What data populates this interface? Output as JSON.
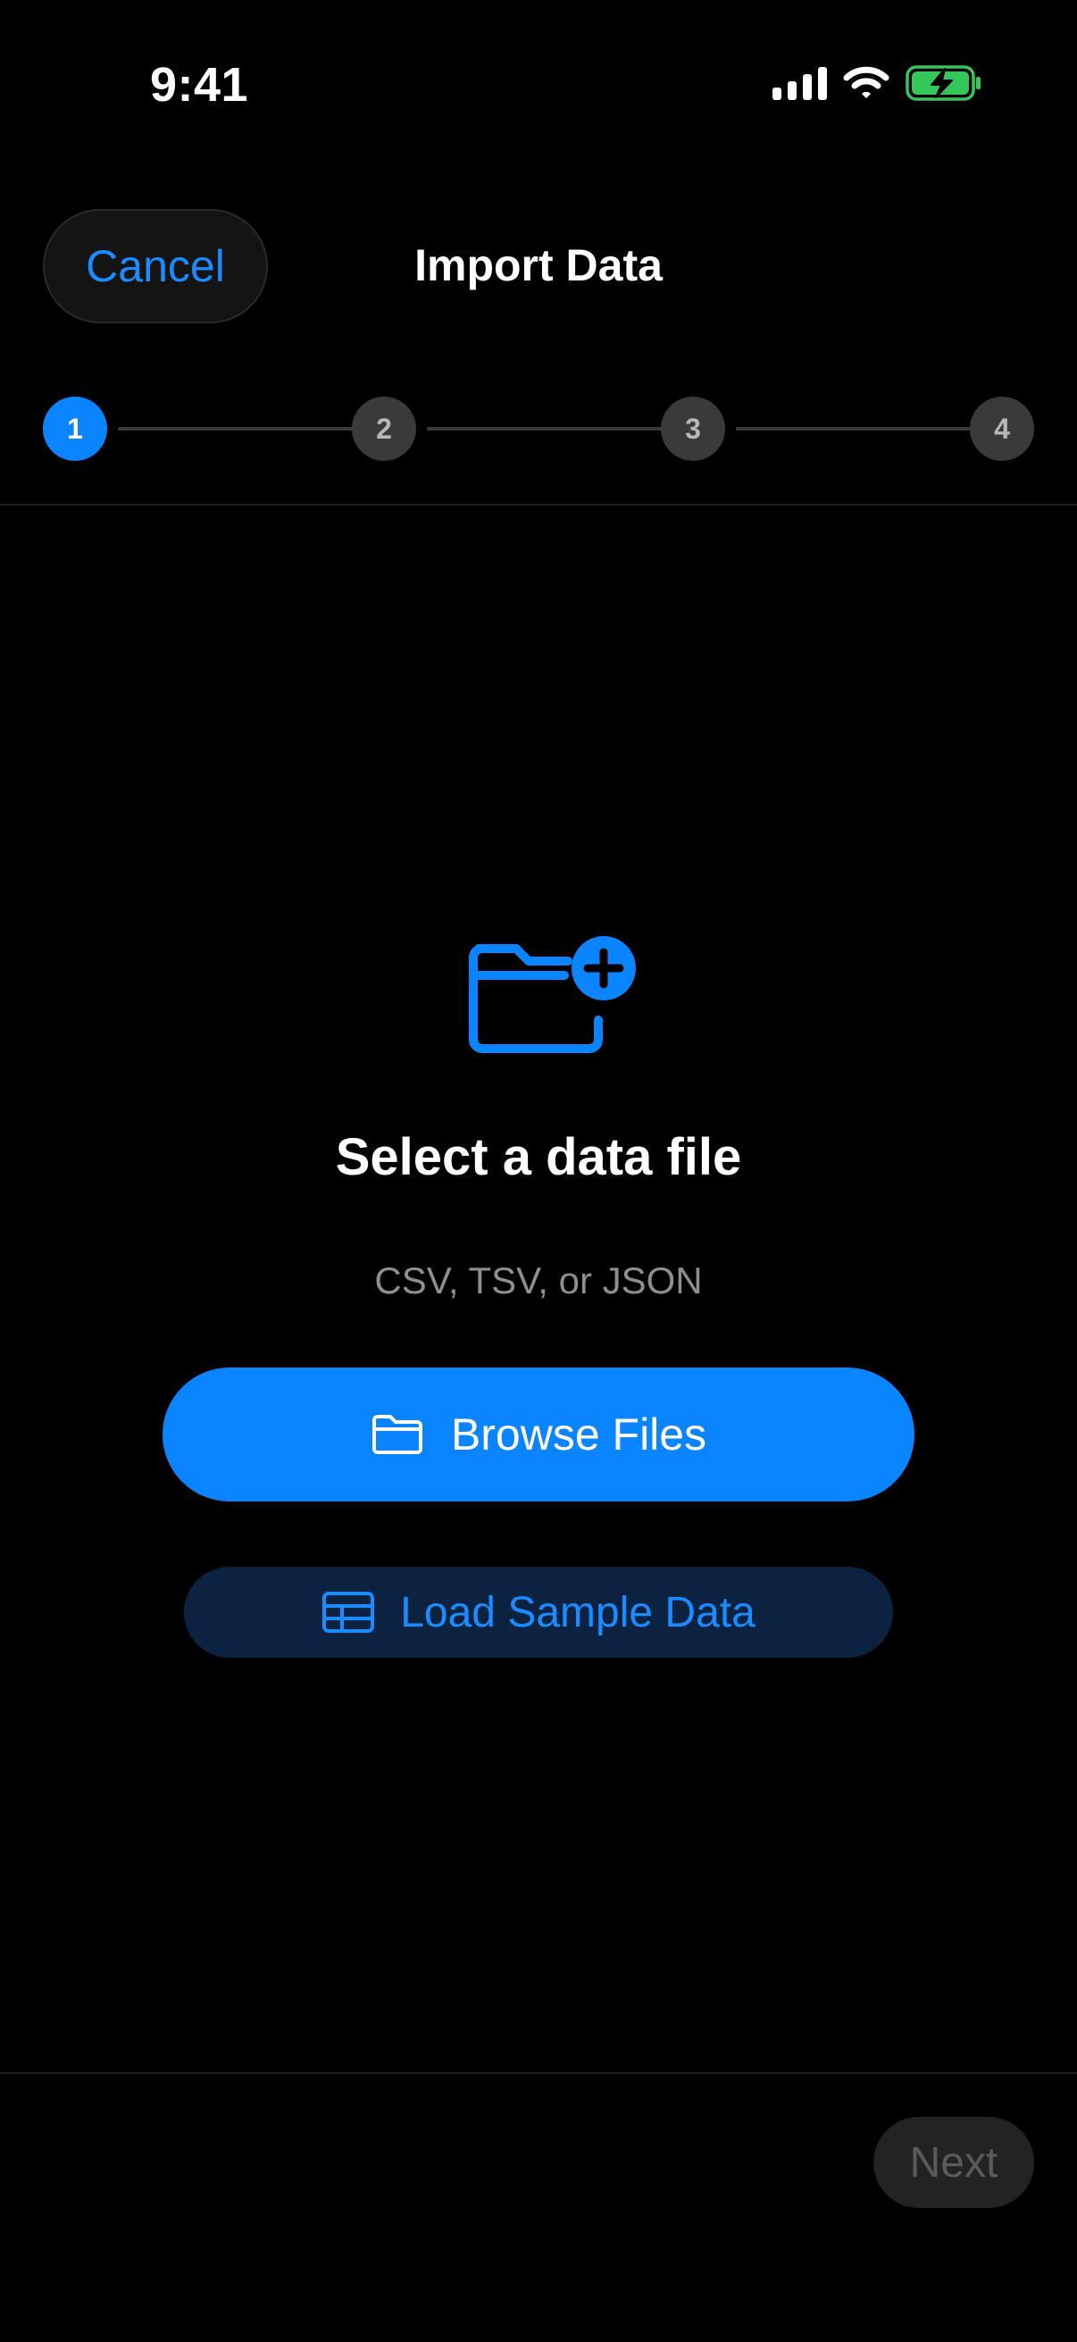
{
  "status_bar": {
    "time": "9:41"
  },
  "nav": {
    "cancel_label": "Cancel",
    "title": "Import Data"
  },
  "stepper": {
    "current_step": 1,
    "steps": [
      {
        "label": "1",
        "state": "active"
      },
      {
        "label": "2",
        "state": "inactive"
      },
      {
        "label": "3",
        "state": "inactive"
      },
      {
        "label": "4",
        "state": "inactive"
      }
    ]
  },
  "main": {
    "icon": "folder-plus-icon",
    "headline": "Select a data file",
    "subhead": "CSV, TSV, or JSON",
    "browse_button": {
      "label": "Browse Files",
      "icon": "folder-icon"
    },
    "sample_button": {
      "label": "Load Sample Data",
      "icon": "table-icon"
    }
  },
  "footer": {
    "next_label": "Next",
    "next_enabled": false
  },
  "colors": {
    "background": "#000000",
    "accent": "#0a84ff",
    "accent_text": "#1a8cff",
    "muted_text": "#8e8e93",
    "inactive_step": "#3a3a3c",
    "battery_green": "#34c759"
  }
}
